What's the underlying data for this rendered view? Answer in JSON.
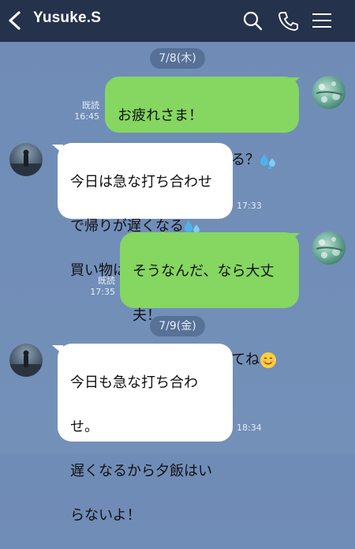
{
  "header": {
    "title": "Yusuke.S",
    "icons": [
      "back-icon",
      "search-icon",
      "phone-icon",
      "menu-icon"
    ],
    "background": "#25324b"
  },
  "colors": {
    "outgoing_bubble": "#86d662",
    "incoming_bubble": "#ffffff",
    "chat_background": "#7390b9"
  },
  "dates": [
    "7/8(木)",
    "7/9(金)"
  ],
  "messages": [
    {
      "side": "out",
      "lines": [
        "お疲れさま！",
        "帰りに買い物頼める？"
      ],
      "emoji": "sweat-drops-icon",
      "read": "既読",
      "time": "16:45"
    },
    {
      "side": "in",
      "lines": [
        "今日は急な打ち合わせ",
        "で帰りが遅くなる",
        "買い物は急ぎ？"
      ],
      "emoji": "sweat-drops-icon",
      "time": "17:33"
    },
    {
      "side": "out",
      "lines": [
        "そうなんだ、なら大丈",
        "夫！",
        "お仕事がんばってね"
      ],
      "emoji": "smiling-face-icon",
      "read": "既読",
      "time": "17:35"
    },
    {
      "side": "in",
      "lines": [
        "今日も急な打ち合わ",
        "せ。",
        "遅くなるから夕飯はい",
        "らないよ！"
      ],
      "time": "18:34"
    }
  ]
}
